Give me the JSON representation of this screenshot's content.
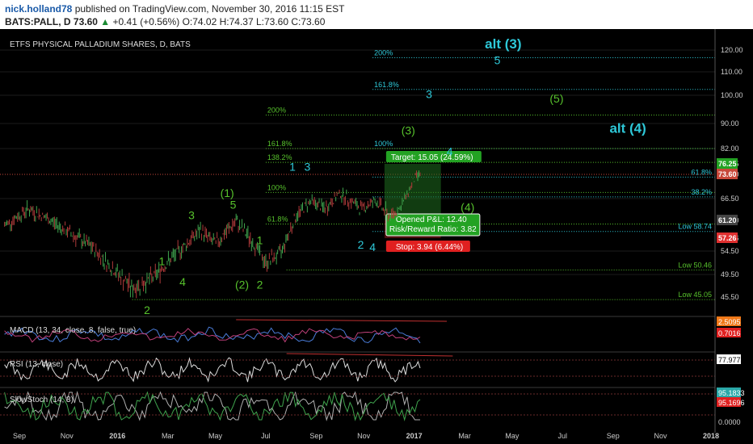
{
  "header": {
    "user": "nick.holland78",
    "published": "published on TradingView.com, November 30, 2016 11:15 EST",
    "symbol": "BATS:PALL, D",
    "last": "73.60",
    "change": "+0.41 (+0.56%)",
    "ohlc": "O:74.02 H:74.37 L:73.60 C:73.60"
  },
  "chart_data": {
    "type": "line",
    "title": "ETFS PHYSICAL PALLADIUM SHARES, D, BATS",
    "x_ticks": [
      "Sep",
      "Nov",
      "2016",
      "Mar",
      "May",
      "Jul",
      "Sep",
      "Nov",
      "2017",
      "Mar",
      "May",
      "Jul",
      "Sep",
      "Nov",
      "2018"
    ],
    "y_ticks": [
      "120.00",
      "110.00",
      "100.00",
      "90.00",
      "82.00",
      "76.25",
      "73.60",
      "66.50",
      "61.20",
      "57.26",
      "54.50",
      "49.50",
      "45.50"
    ],
    "ylim": [
      43.5,
      126
    ],
    "price_anchors": [
      [
        2015.62,
        60
      ],
      [
        2015.7,
        64
      ],
      [
        2015.78,
        61
      ],
      [
        2015.85,
        58
      ],
      [
        2015.92,
        55
      ],
      [
        2015.98,
        51
      ],
      [
        2016.05,
        47
      ],
      [
        2016.12,
        49
      ],
      [
        2016.2,
        54
      ],
      [
        2016.28,
        59
      ],
      [
        2016.33,
        56
      ],
      [
        2016.4,
        61
      ],
      [
        2016.45,
        57
      ],
      [
        2016.5,
        52
      ],
      [
        2016.55,
        54
      ],
      [
        2016.6,
        62
      ],
      [
        2016.65,
        66
      ],
      [
        2016.7,
        64
      ],
      [
        2016.75,
        68
      ],
      [
        2016.82,
        64
      ],
      [
        2016.87,
        66
      ],
      [
        2016.92,
        62
      ],
      [
        2016.96,
        65
      ],
      [
        2017.0,
        72
      ],
      [
        2017.02,
        74
      ]
    ],
    "levels": [
      {
        "label": "200%",
        "price": 116.5,
        "x0": 2016.86,
        "color": "#2ec8d8"
      },
      {
        "label": "161.8%",
        "price": 102.5,
        "x0": 2016.86,
        "color": "#2ec8d8"
      },
      {
        "label": "200%",
        "price": 93.0,
        "x0": 2016.5,
        "color": "#57c22c"
      },
      {
        "label": "100%",
        "price": 82.0,
        "x0": 2016.86,
        "color": "#2ec8d8"
      },
      {
        "label": "161.8%",
        "price": 82.0,
        "x0": 2016.5,
        "color": "#57c22c"
      },
      {
        "label": "138.2%",
        "price": 76.8,
        "x0": 2016.5,
        "color": "#57c22c"
      },
      {
        "label": "61.8%",
        "price": 72.8,
        "x0": 2016.86,
        "color": "#2ec8d8"
      },
      {
        "label": "100%",
        "price": 68.3,
        "x0": 2016.5,
        "color": "#57c22c"
      },
      {
        "label": "38.2%",
        "price": 67.0,
        "x0": 2016.86,
        "color": "#2ec8d8"
      },
      {
        "label": "61.8%",
        "price": 60.4,
        "x0": 2016.5,
        "color": "#57c22c"
      },
      {
        "label": "Low 58.74",
        "price": 58.74,
        "x0": 2016.86,
        "color": "#2ec8d8"
      },
      {
        "label": "Low 50.46",
        "price": 50.46,
        "x0": 2016.57,
        "color": "#57c22c"
      },
      {
        "label": "Low 45.05",
        "price": 45.05,
        "x0": 2016.05,
        "color": "#57c22c"
      }
    ],
    "wave_labels": [
      {
        "text": "alt (3)",
        "x": 2017.3,
        "price": 120.8,
        "color": "#2ec8d8",
        "big": true
      },
      {
        "text": "5",
        "x": 2017.28,
        "price": 113.5,
        "color": "#2ec8d8"
      },
      {
        "text": "3",
        "x": 2017.05,
        "price": 99.0,
        "color": "#2ec8d8"
      },
      {
        "text": "(5)",
        "x": 2017.48,
        "price": 97.5,
        "color": "#57c22c"
      },
      {
        "text": "alt (4)",
        "x": 2017.72,
        "price": 87.0,
        "color": "#2ec8d8",
        "big": true
      },
      {
        "text": "(3)",
        "x": 2016.98,
        "price": 86.5,
        "color": "#57c22c"
      },
      {
        "text": "4",
        "x": 2017.12,
        "price": 79.5,
        "color": "#2ec8d8"
      },
      {
        "text": "1",
        "x": 2016.59,
        "price": 74.5,
        "color": "#2ec8d8"
      },
      {
        "text": "3",
        "x": 2016.64,
        "price": 74.5,
        "color": "#2ec8d8"
      },
      {
        "text": "(1)",
        "x": 2016.37,
        "price": 67.0,
        "color": "#57c22c"
      },
      {
        "text": "5",
        "x": 2016.39,
        "price": 64.0,
        "color": "#57c22c"
      },
      {
        "text": "3",
        "x": 2016.25,
        "price": 61.5,
        "color": "#57c22c"
      },
      {
        "text": "(4)",
        "x": 2017.18,
        "price": 63.5,
        "color": "#57c22c"
      },
      {
        "text": "1",
        "x": 2016.48,
        "price": 56.0,
        "color": "#57c22c"
      },
      {
        "text": "2",
        "x": 2016.82,
        "price": 55.0,
        "color": "#2ec8d8"
      },
      {
        "text": "4",
        "x": 2016.86,
        "price": 54.5,
        "color": "#2ec8d8"
      },
      {
        "text": "1",
        "x": 2016.15,
        "price": 51.5,
        "color": "#57c22c"
      },
      {
        "text": "4",
        "x": 2016.22,
        "price": 47.5,
        "color": "#57c22c"
      },
      {
        "text": "(2)",
        "x": 2016.42,
        "price": 47.0,
        "color": "#57c22c"
      },
      {
        "text": "2",
        "x": 2016.48,
        "price": 47.0,
        "color": "#57c22c"
      },
      {
        "text": "2",
        "x": 2016.1,
        "price": 42.5,
        "color": "#57c22c"
      }
    ],
    "position_tool": {
      "target": "Target: 15.05 (24.59%)",
      "pl": "Opened P&L: 12.40",
      "rr": "Risk/Reward Ratio: 3.82",
      "stop": "Stop: 3.94 (6.44%)",
      "entry": 61.2,
      "target_price": 76.25,
      "stop_price": 57.26,
      "x0": 2016.9,
      "x1": 2017.09
    },
    "price_tags": [
      {
        "text": "76.25",
        "price": 76.25,
        "color": "#23a223"
      },
      {
        "text": "73.60",
        "price": 73.6,
        "color": "#c8483a"
      },
      {
        "text": "61.20",
        "price": 61.2,
        "color": "#444444"
      },
      {
        "text": "57.26",
        "price": 57.26,
        "color": "#e03030"
      }
    ],
    "macd": {
      "label": "MACD (13, 34, close, 8, false, true)",
      "value1": "2.5095",
      "value2": "0.7016"
    },
    "rsi": {
      "label": "RSI (13, close)",
      "value": "77.9775"
    },
    "stoch": {
      "label": "SlowStoch (14, 3)",
      "value1": "95.1833",
      "value2": "95.1696",
      "zero": "0.0000"
    }
  }
}
